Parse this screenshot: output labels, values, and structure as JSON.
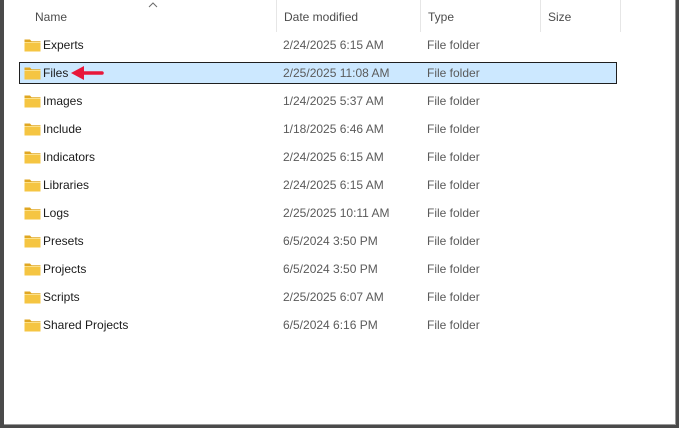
{
  "columns": {
    "name": "Name",
    "date_modified": "Date modified",
    "type": "Type",
    "size": "Size"
  },
  "sort": {
    "column": "name",
    "direction": "ascending"
  },
  "selected_item": "Files",
  "annotation": {
    "icon": "red-arrow-icon",
    "color": "#e8173a",
    "points_to": "Files"
  },
  "folder_icon": {
    "icon": "folder-icon",
    "color": "#f5c542"
  },
  "items": [
    {
      "name": "Experts",
      "date": "2/24/2025 6:15 AM",
      "type": "File folder",
      "size": ""
    },
    {
      "name": "Files",
      "date": "2/25/2025 11:08 AM",
      "type": "File folder",
      "size": ""
    },
    {
      "name": "Images",
      "date": "1/24/2025 5:37 AM",
      "type": "File folder",
      "size": ""
    },
    {
      "name": "Include",
      "date": "1/18/2025 6:46 AM",
      "type": "File folder",
      "size": ""
    },
    {
      "name": "Indicators",
      "date": "2/24/2025 6:15 AM",
      "type": "File folder",
      "size": ""
    },
    {
      "name": "Libraries",
      "date": "2/24/2025 6:15 AM",
      "type": "File folder",
      "size": ""
    },
    {
      "name": "Logs",
      "date": "2/25/2025 10:11 AM",
      "type": "File folder",
      "size": ""
    },
    {
      "name": "Presets",
      "date": "6/5/2024 3:50 PM",
      "type": "File folder",
      "size": ""
    },
    {
      "name": "Projects",
      "date": "6/5/2024 3:50 PM",
      "type": "File folder",
      "size": ""
    },
    {
      "name": "Scripts",
      "date": "2/25/2025 6:07 AM",
      "type": "File folder",
      "size": ""
    },
    {
      "name": "Shared Projects",
      "date": "6/5/2024 6:16 PM",
      "type": "File folder",
      "size": ""
    }
  ]
}
